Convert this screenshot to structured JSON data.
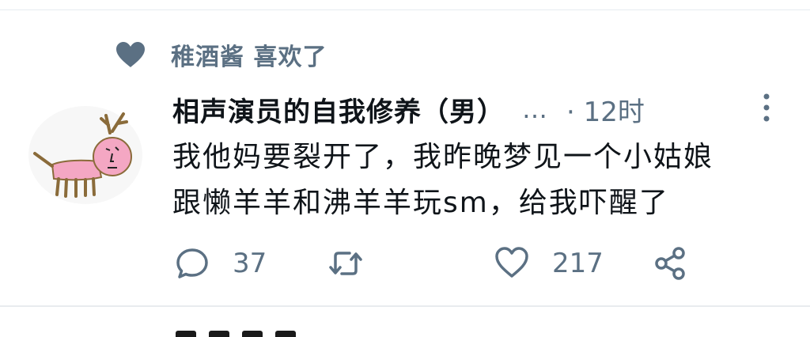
{
  "liked_by": {
    "text": "稚酒酱 喜欢了",
    "icon": "heart-icon"
  },
  "tweet": {
    "author_name": "相声演员的自我修养（男）",
    "ellipsis": "…",
    "timestamp": "· 12时",
    "lines": [
      "我他妈要裂开了，我昨晚梦见一个小姑娘",
      "跟懒羊羊和沸羊羊玩sm，给我吓醒了"
    ],
    "avatar_icon": "pink-drawn-creature-avatar"
  },
  "actions": {
    "reply_count": "37",
    "retweet_count": "",
    "like_count": "217"
  },
  "colors": {
    "muted": "#5b7083",
    "text": "#0f1419",
    "divider": "#e6ecf0",
    "avatar_pink": "#f4a7c3"
  }
}
